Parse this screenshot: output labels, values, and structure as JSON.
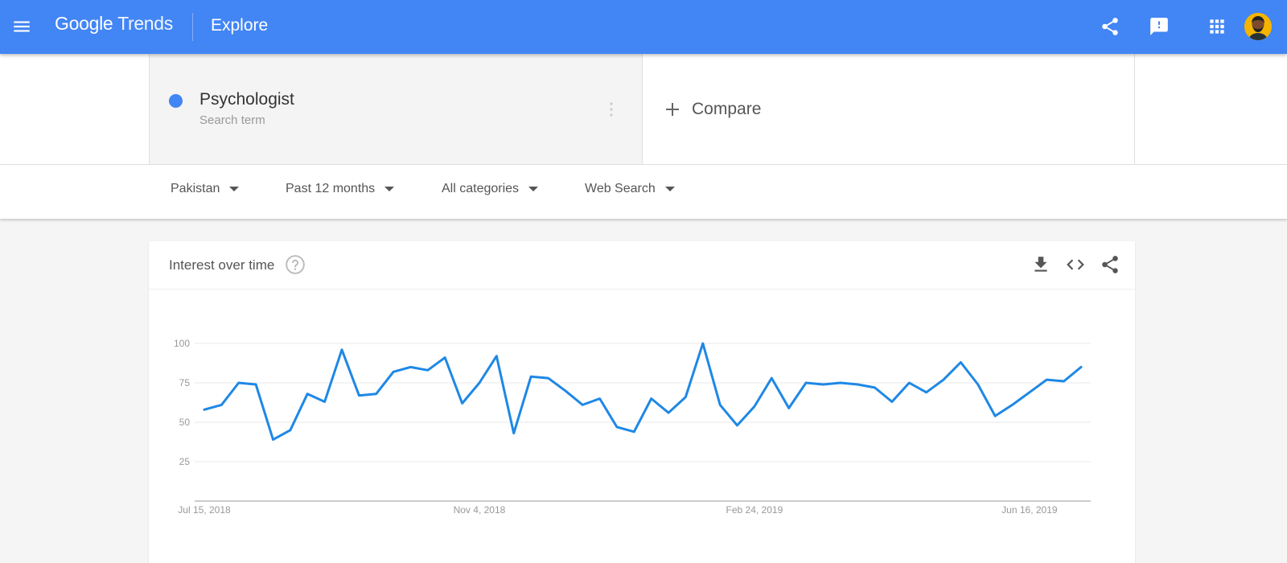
{
  "header": {
    "logo_google": "Google",
    "logo_trends": "Trends",
    "page_title": "Explore"
  },
  "search_term": {
    "name": "Psychologist",
    "type": "Search term",
    "color": "#4285f4"
  },
  "compare": {
    "label": "Compare"
  },
  "filters": [
    {
      "label": "Pakistan"
    },
    {
      "label": "Past 12 months"
    },
    {
      "label": "All categories"
    },
    {
      "label": "Web Search"
    }
  ],
  "card": {
    "title": "Interest over time"
  },
  "chart_data": {
    "type": "line",
    "title": "",
    "xlabel": "",
    "ylabel": "",
    "ylim": [
      0,
      100
    ],
    "yticks": [
      25,
      50,
      75,
      100
    ],
    "xtick_labels": [
      "Jul 15, 2018",
      "Nov 4, 2018",
      "Feb 24, 2019",
      "Jun 16, 2019"
    ],
    "xtick_indices": [
      0,
      16,
      32,
      48
    ],
    "grid": true,
    "line_color": "#1e88e5",
    "series": [
      {
        "values": [
          58,
          61,
          75,
          74,
          39,
          45,
          68,
          63,
          96,
          67,
          68,
          82,
          85,
          83,
          91,
          62,
          75,
          92,
          43,
          79,
          78,
          70,
          61,
          65,
          47,
          44,
          65,
          56,
          66,
          100,
          61,
          48,
          60,
          78,
          59,
          75,
          74,
          75,
          74,
          72,
          63,
          75,
          69,
          77,
          88,
          74,
          54,
          61,
          69,
          77,
          76,
          85
        ]
      }
    ]
  }
}
